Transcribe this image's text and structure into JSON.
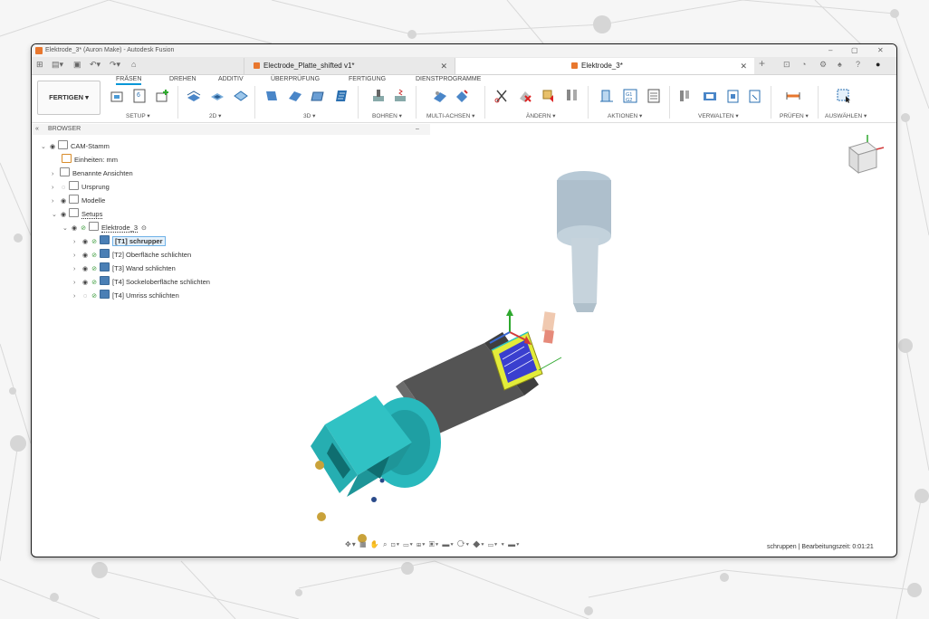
{
  "window": {
    "title": "Elektrode_3* (Auron Make) - Autodesk Fusion"
  },
  "tabs": [
    {
      "label": "Electrode_Platte_shifted v1*",
      "active": false
    },
    {
      "label": "Elektrode_3*",
      "active": true
    }
  ],
  "ribbon": {
    "workspace": "FERTIGEN ▾",
    "tabs": [
      "FRÄSEN",
      "DREHEN",
      "ADDITIV",
      "ÜBERPRÜFUNG",
      "FERTIGUNG",
      "DIENSTPROGRAMME"
    ],
    "active_tab": "FRÄSEN",
    "groups": [
      "SETUP ▾",
      "2D ▾",
      "3D ▾",
      "BOHREN ▾",
      "MULTI-ACHSEN ▾",
      "ÄNDERN ▾",
      "AKTIONEN ▾",
      "VERWALTEN ▾",
      "PRÜFEN ▾",
      "AUSWÄHLEN ▾"
    ]
  },
  "browser": {
    "label": "BROWSER",
    "items": [
      {
        "label": "CAM-Stamm"
      },
      {
        "label": "Einheiten: mm"
      },
      {
        "label": "Benannte Ansichten"
      },
      {
        "label": "Ursprung"
      },
      {
        "label": "Modelle"
      },
      {
        "label": "Setups"
      },
      {
        "label": "Elektrode_3"
      },
      {
        "label": "[T1] schrupper",
        "selected": true
      },
      {
        "label": "[T2] Oberfläche schlichten"
      },
      {
        "label": "[T3] Wand schlichten"
      },
      {
        "label": "[T4] Sockeloberfläche schlichten"
      },
      {
        "label": "[T4] Umriss schlichten"
      }
    ]
  },
  "status": {
    "text": "schruppen | Bearbeitungszeit: 0:01:21"
  },
  "colors": {
    "accent": "#0696d7",
    "part": "#2ec4c4",
    "holder": "#aab8c2"
  }
}
